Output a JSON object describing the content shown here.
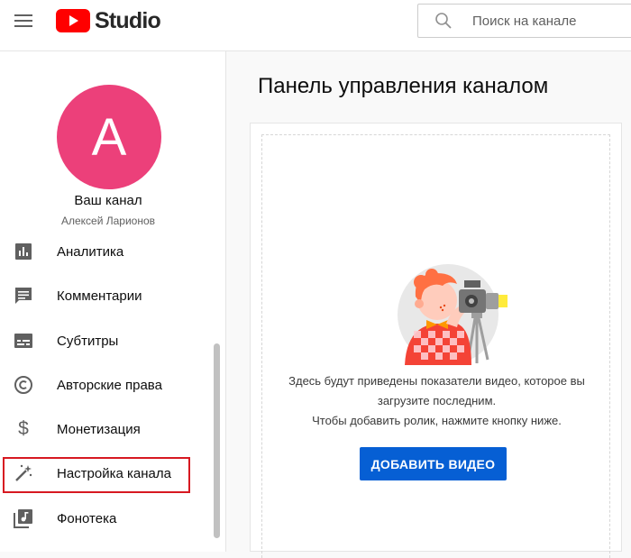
{
  "header": {
    "logo_text": "Studio",
    "search_placeholder": "Поиск на канале"
  },
  "sidebar": {
    "avatar_letter": "A",
    "channel_title": "Ваш канал",
    "channel_name": "Алексей Ларионов",
    "items": [
      {
        "label": "Аналитика",
        "icon": "analytics-icon"
      },
      {
        "label": "Комментарии",
        "icon": "comments-icon"
      },
      {
        "label": "Субтитры",
        "icon": "subtitles-icon"
      },
      {
        "label": "Авторские права",
        "icon": "copyright-icon"
      },
      {
        "label": "Монетизация",
        "icon": "dollar-icon"
      },
      {
        "label": "Настройка канала",
        "icon": "magic-wand-icon"
      },
      {
        "label": "Фонотека",
        "icon": "audio-library-icon"
      }
    ],
    "highlighted_item": "Настройка канала"
  },
  "main": {
    "title": "Панель управления каналом",
    "empty_message_line1": "Здесь будут приведены показатели видео, которое вы",
    "empty_message_line2": "загрузите последним.",
    "empty_message_line3": "Чтобы добавить ролик, нажмите кнопку ниже.",
    "upload_button": "ДОБАВИТЬ ВИДЕО"
  },
  "colors": {
    "accent": "#065fd4",
    "avatar": "#ec407a",
    "youtube_red": "#ff0000",
    "highlight": "#d71921"
  }
}
